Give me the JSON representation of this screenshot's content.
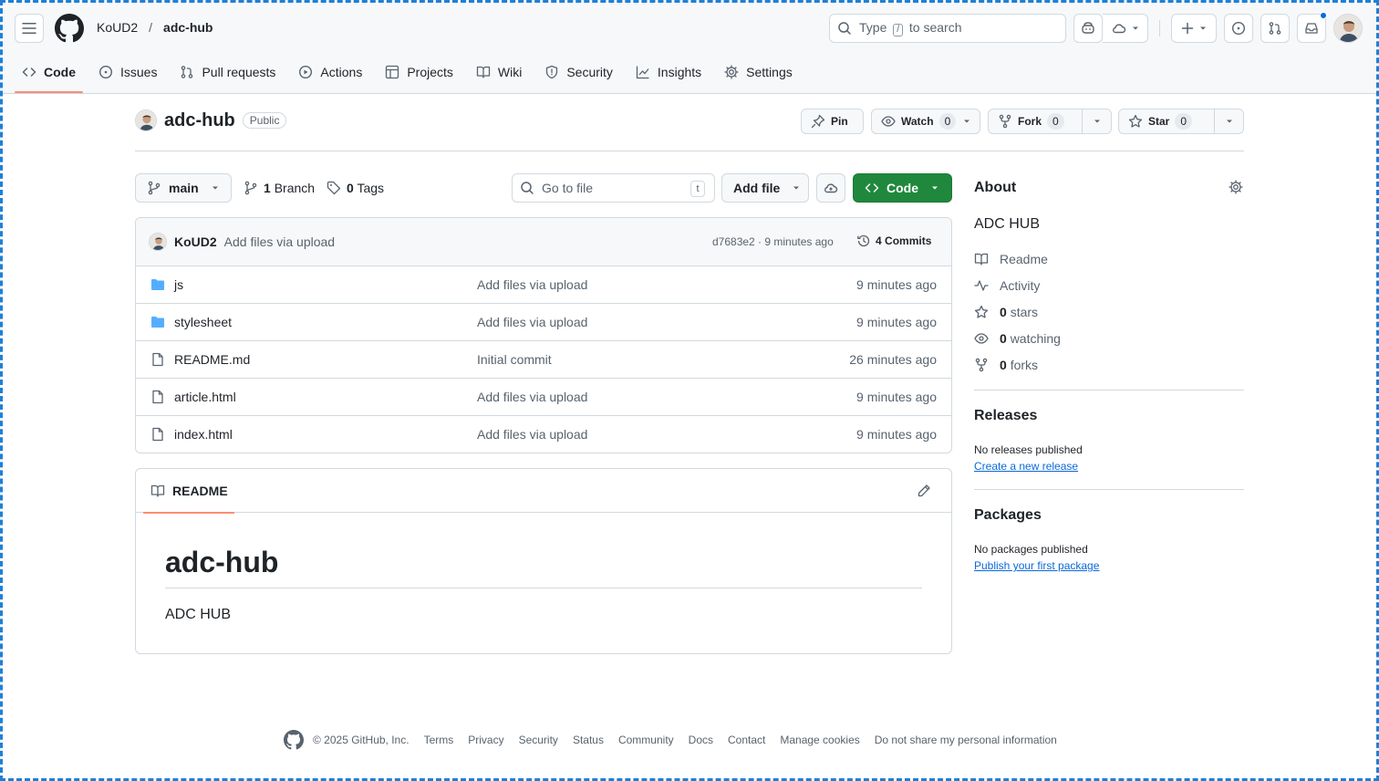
{
  "header": {
    "owner": "KoUD2",
    "separator": "/",
    "repo": "adc-hub",
    "search_prefix": "Type",
    "search_key": "/",
    "search_suffix": "to search"
  },
  "tabs": [
    {
      "label": "Code",
      "icon": "code-icon",
      "active": true
    },
    {
      "label": "Issues",
      "icon": "issue-opened-icon"
    },
    {
      "label": "Pull requests",
      "icon": "git-pull-request-icon"
    },
    {
      "label": "Actions",
      "icon": "play-icon"
    },
    {
      "label": "Projects",
      "icon": "table-icon"
    },
    {
      "label": "Wiki",
      "icon": "book-icon"
    },
    {
      "label": "Security",
      "icon": "shield-icon"
    },
    {
      "label": "Insights",
      "icon": "graph-icon"
    },
    {
      "label": "Settings",
      "icon": "gear-icon"
    }
  ],
  "repo": {
    "name": "adc-hub",
    "visibility": "Public",
    "pin_label": "Pin",
    "watch_label": "Watch",
    "watch_count": "0",
    "fork_label": "Fork",
    "fork_count": "0",
    "star_label": "Star",
    "star_count": "0"
  },
  "controls": {
    "branch": "main",
    "branch_count": "1",
    "branch_label": "Branch",
    "tag_count": "0",
    "tag_label": "Tags",
    "goto_placeholder": "Go to file",
    "goto_key": "t",
    "add_file": "Add file",
    "code_button": "Code"
  },
  "commit": {
    "author": "KoUD2",
    "message": "Add files via upload",
    "sha_time": "d7683e2 · 9 minutes ago",
    "commits_count": "4",
    "commits_label": "Commits"
  },
  "files": [
    {
      "name": "js",
      "type": "folder",
      "message": "Add files via upload",
      "time": "9 minutes ago"
    },
    {
      "name": "stylesheet",
      "type": "folder",
      "message": "Add files via upload",
      "time": "9 minutes ago"
    },
    {
      "name": "README.md",
      "type": "file",
      "message": "Initial commit",
      "time": "26 minutes ago"
    },
    {
      "name": "article.html",
      "type": "file",
      "message": "Add files via upload",
      "time": "9 minutes ago"
    },
    {
      "name": "index.html",
      "type": "file",
      "message": "Add files via upload",
      "time": "9 minutes ago"
    }
  ],
  "readme": {
    "tab_label": "README",
    "heading": "adc-hub",
    "body": "ADC HUB"
  },
  "about": {
    "title": "About",
    "description": "ADC HUB",
    "readme_label": "Readme",
    "activity_label": "Activity",
    "stars_count": "0",
    "stars_label": "stars",
    "watching_count": "0",
    "watching_label": "watching",
    "forks_count": "0",
    "forks_label": "forks"
  },
  "releases": {
    "title": "Releases",
    "empty": "No releases published",
    "link": "Create a new release"
  },
  "packages": {
    "title": "Packages",
    "empty": "No packages published",
    "link": "Publish your first package"
  },
  "footer": {
    "copyright": "© 2025 GitHub, Inc.",
    "links": [
      "Terms",
      "Privacy",
      "Security",
      "Status",
      "Community",
      "Docs",
      "Contact",
      "Manage cookies",
      "Do not share my personal information"
    ]
  },
  "colors": {
    "accent_tab": "#fd8c73",
    "code_button": "#1f883d",
    "link": "#0969da",
    "folder": "#54aeff",
    "notification_dot": "#0969da"
  }
}
